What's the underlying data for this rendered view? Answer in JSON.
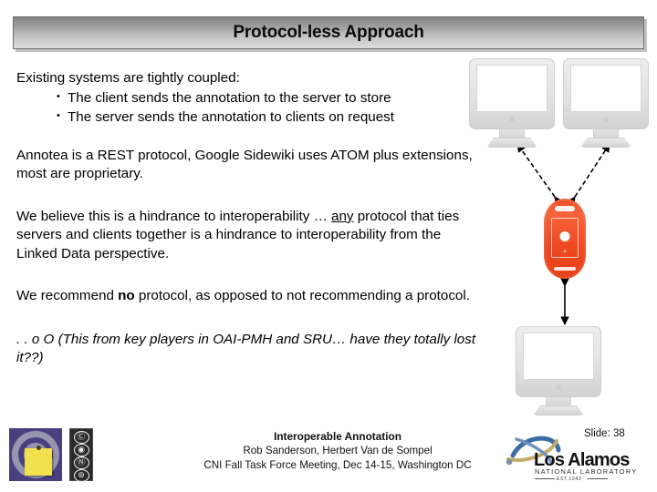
{
  "slide": {
    "title": "Protocol-less Approach",
    "body": {
      "intro": "Existing systems are tightly coupled:",
      "bullets": [
        "The client sends the annotation to the server to store",
        "The server sends the annotation to clients on request"
      ],
      "paragraph_annotea": "Annotea is a REST protocol, Google Sidewiki uses ATOM plus extensions, most are proprietary.",
      "paragraph_hindrance_part1": "We believe this is a hindrance to interoperability … ",
      "paragraph_hindrance_emphasis": "any",
      "paragraph_hindrance_part2": " protocol that ties servers and clients together is a hindrance to interoperability from the Linked Data perspective.",
      "paragraph_recommend_part1": "We recommend ",
      "paragraph_recommend_emphasis": "no",
      "paragraph_recommend_part2": " protocol, as opposed to not recommending a protocol.",
      "paragraph_aside": ". . o O (This from key players in OAI-PMH and SRU… have they totally lost it??)"
    },
    "diagram": {
      "nodes": [
        {
          "name": "client-monitor-top-left",
          "type": "monitor",
          "logo": ""
        },
        {
          "name": "client-monitor-top-right",
          "type": "monitor",
          "logo": ""
        },
        {
          "name": "mobile-device",
          "type": "phone",
          "color": "#ef4a22"
        },
        {
          "name": "client-monitor-bottom",
          "type": "monitor",
          "logo": ""
        }
      ],
      "connections": [
        {
          "from": "mobile-device",
          "to": "client-monitor-top-left",
          "style": "double-arrow-dashed"
        },
        {
          "from": "mobile-device",
          "to": "client-monitor-top-right",
          "style": "double-arrow-dashed"
        },
        {
          "from": "mobile-device",
          "to": "client-monitor-bottom",
          "style": "double-arrow-solid"
        }
      ]
    },
    "footer": {
      "title": "Interoperable Annotation",
      "authors": "Rob Sanderson, Herbert Van de Sompel",
      "event": "CNI Fall Task Force Meeting, Dec 14-15, Washington DC",
      "slide_number": "Slide: 38"
    },
    "logos": {
      "annotation_logo_name": "annotation-target-sticky-note-logo",
      "creative_commons_badge": {
        "icons": [
          "cc-icon",
          "by-icon",
          "nc-icon",
          "sa-icon"
        ],
        "glyphs": [
          "Ⓒ",
          "◉",
          "Ⓝ",
          "⊚"
        ]
      },
      "lanl": {
        "wordmark": "Los Alamos",
        "subtitle": "NATIONAL LABORATORY",
        "established": "EST.1943"
      }
    },
    "colors": {
      "title_gradient_top": "#828282",
      "title_gradient_bottom": "#dcdcdc",
      "phone": "#ef4a22",
      "logo_purple": "#4a4080",
      "sticky_yellow": "#f2e14f"
    }
  }
}
